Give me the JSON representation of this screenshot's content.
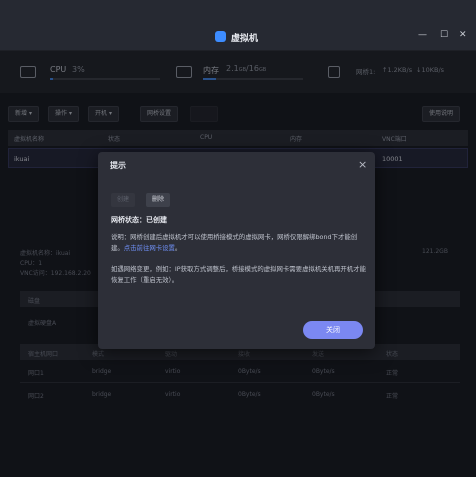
{
  "window": {
    "title": "虚拟机",
    "controls": [
      "—",
      "☐",
      "✕"
    ]
  },
  "stats": {
    "cpu": {
      "label": "CPU",
      "value": "3%",
      "percent": 3
    },
    "memory": {
      "label": "内存",
      "used": "2.1",
      "unit_used": "GB",
      "sep": "/",
      "total": "16",
      "unit_total": "GB",
      "percent": 13
    },
    "network": {
      "label": "网桥1:",
      "up": "↑1.2KB/s",
      "down": "↓10KB/s"
    }
  },
  "toolbar": {
    "new": "新增",
    "operate": "操作",
    "power": "开机",
    "bridge": "网桥设置",
    "disabled": "",
    "help": "使用说明"
  },
  "table": {
    "headers": [
      "虚拟机名称",
      "状态",
      "CPU",
      "内存",
      "VNC端口"
    ],
    "rows": [
      {
        "name": "ikuai",
        "vnc": "10001"
      }
    ]
  },
  "details": {
    "name_line": "虚拟机名称：ikuai",
    "cpu_line": "CPU：1",
    "vnc_line": "VNC访问：192.168.2.20",
    "disk_size": "121.2GB",
    "disk_header": "磁盘",
    "disk_row": "虚拟硬盘A",
    "nic_headers": [
      "宿主机网口",
      "模式",
      "驱动",
      "接收",
      "发送",
      "状态"
    ],
    "nics": [
      {
        "port": "网口1",
        "mode": "bridge",
        "driver": "virtio",
        "rx": "0Byte/s",
        "tx": "0Byte/s",
        "status": "正常"
      },
      {
        "port": "网口2",
        "mode": "bridge",
        "driver": "virtio",
        "rx": "0Byte/s",
        "tx": "0Byte/s",
        "status": "正常"
      }
    ]
  },
  "dialog": {
    "title": "提示",
    "btn_disabled": "创建",
    "btn_delete": "删除",
    "status": "网桥状态：已创建",
    "para1_a": "说明：网桥创建后虚拟机才可以使用桥接模式的虚拟网卡，网桥仅限解绑bond下才能创建。",
    "para1_link": "点击前往网卡设置",
    "para2": "如遇网络变更，例如：IP获取方式调整后，桥接模式的虚拟网卡需要虚拟机关机再开机才能恢复工作（重启无效）。",
    "close": "关闭"
  }
}
